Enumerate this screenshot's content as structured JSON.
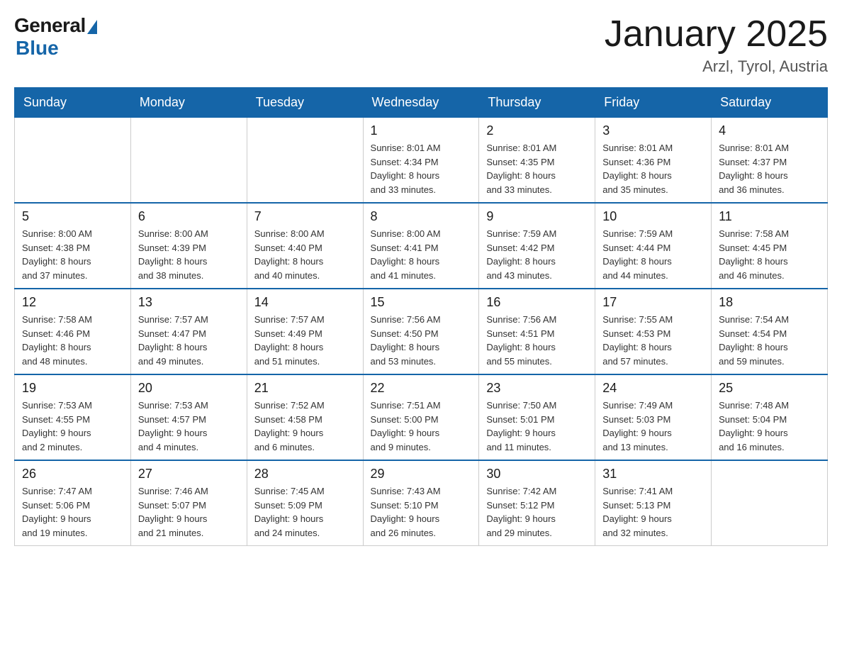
{
  "header": {
    "logo_general": "General",
    "logo_blue": "Blue",
    "title": "January 2025",
    "subtitle": "Arzl, Tyrol, Austria"
  },
  "days_of_week": [
    "Sunday",
    "Monday",
    "Tuesday",
    "Wednesday",
    "Thursday",
    "Friday",
    "Saturday"
  ],
  "weeks": [
    [
      {
        "day": "",
        "info": ""
      },
      {
        "day": "",
        "info": ""
      },
      {
        "day": "",
        "info": ""
      },
      {
        "day": "1",
        "info": "Sunrise: 8:01 AM\nSunset: 4:34 PM\nDaylight: 8 hours\nand 33 minutes."
      },
      {
        "day": "2",
        "info": "Sunrise: 8:01 AM\nSunset: 4:35 PM\nDaylight: 8 hours\nand 33 minutes."
      },
      {
        "day": "3",
        "info": "Sunrise: 8:01 AM\nSunset: 4:36 PM\nDaylight: 8 hours\nand 35 minutes."
      },
      {
        "day": "4",
        "info": "Sunrise: 8:01 AM\nSunset: 4:37 PM\nDaylight: 8 hours\nand 36 minutes."
      }
    ],
    [
      {
        "day": "5",
        "info": "Sunrise: 8:00 AM\nSunset: 4:38 PM\nDaylight: 8 hours\nand 37 minutes."
      },
      {
        "day": "6",
        "info": "Sunrise: 8:00 AM\nSunset: 4:39 PM\nDaylight: 8 hours\nand 38 minutes."
      },
      {
        "day": "7",
        "info": "Sunrise: 8:00 AM\nSunset: 4:40 PM\nDaylight: 8 hours\nand 40 minutes."
      },
      {
        "day": "8",
        "info": "Sunrise: 8:00 AM\nSunset: 4:41 PM\nDaylight: 8 hours\nand 41 minutes."
      },
      {
        "day": "9",
        "info": "Sunrise: 7:59 AM\nSunset: 4:42 PM\nDaylight: 8 hours\nand 43 minutes."
      },
      {
        "day": "10",
        "info": "Sunrise: 7:59 AM\nSunset: 4:44 PM\nDaylight: 8 hours\nand 44 minutes."
      },
      {
        "day": "11",
        "info": "Sunrise: 7:58 AM\nSunset: 4:45 PM\nDaylight: 8 hours\nand 46 minutes."
      }
    ],
    [
      {
        "day": "12",
        "info": "Sunrise: 7:58 AM\nSunset: 4:46 PM\nDaylight: 8 hours\nand 48 minutes."
      },
      {
        "day": "13",
        "info": "Sunrise: 7:57 AM\nSunset: 4:47 PM\nDaylight: 8 hours\nand 49 minutes."
      },
      {
        "day": "14",
        "info": "Sunrise: 7:57 AM\nSunset: 4:49 PM\nDaylight: 8 hours\nand 51 minutes."
      },
      {
        "day": "15",
        "info": "Sunrise: 7:56 AM\nSunset: 4:50 PM\nDaylight: 8 hours\nand 53 minutes."
      },
      {
        "day": "16",
        "info": "Sunrise: 7:56 AM\nSunset: 4:51 PM\nDaylight: 8 hours\nand 55 minutes."
      },
      {
        "day": "17",
        "info": "Sunrise: 7:55 AM\nSunset: 4:53 PM\nDaylight: 8 hours\nand 57 minutes."
      },
      {
        "day": "18",
        "info": "Sunrise: 7:54 AM\nSunset: 4:54 PM\nDaylight: 8 hours\nand 59 minutes."
      }
    ],
    [
      {
        "day": "19",
        "info": "Sunrise: 7:53 AM\nSunset: 4:55 PM\nDaylight: 9 hours\nand 2 minutes."
      },
      {
        "day": "20",
        "info": "Sunrise: 7:53 AM\nSunset: 4:57 PM\nDaylight: 9 hours\nand 4 minutes."
      },
      {
        "day": "21",
        "info": "Sunrise: 7:52 AM\nSunset: 4:58 PM\nDaylight: 9 hours\nand 6 minutes."
      },
      {
        "day": "22",
        "info": "Sunrise: 7:51 AM\nSunset: 5:00 PM\nDaylight: 9 hours\nand 9 minutes."
      },
      {
        "day": "23",
        "info": "Sunrise: 7:50 AM\nSunset: 5:01 PM\nDaylight: 9 hours\nand 11 minutes."
      },
      {
        "day": "24",
        "info": "Sunrise: 7:49 AM\nSunset: 5:03 PM\nDaylight: 9 hours\nand 13 minutes."
      },
      {
        "day": "25",
        "info": "Sunrise: 7:48 AM\nSunset: 5:04 PM\nDaylight: 9 hours\nand 16 minutes."
      }
    ],
    [
      {
        "day": "26",
        "info": "Sunrise: 7:47 AM\nSunset: 5:06 PM\nDaylight: 9 hours\nand 19 minutes."
      },
      {
        "day": "27",
        "info": "Sunrise: 7:46 AM\nSunset: 5:07 PM\nDaylight: 9 hours\nand 21 minutes."
      },
      {
        "day": "28",
        "info": "Sunrise: 7:45 AM\nSunset: 5:09 PM\nDaylight: 9 hours\nand 24 minutes."
      },
      {
        "day": "29",
        "info": "Sunrise: 7:43 AM\nSunset: 5:10 PM\nDaylight: 9 hours\nand 26 minutes."
      },
      {
        "day": "30",
        "info": "Sunrise: 7:42 AM\nSunset: 5:12 PM\nDaylight: 9 hours\nand 29 minutes."
      },
      {
        "day": "31",
        "info": "Sunrise: 7:41 AM\nSunset: 5:13 PM\nDaylight: 9 hours\nand 32 minutes."
      },
      {
        "day": "",
        "info": ""
      }
    ]
  ]
}
